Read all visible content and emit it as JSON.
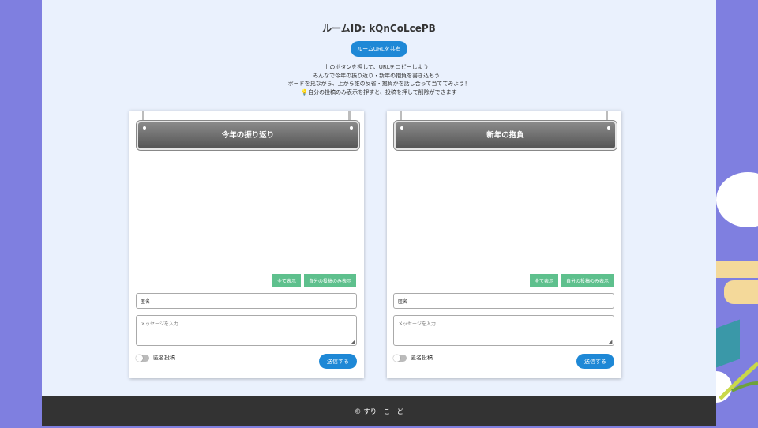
{
  "header": {
    "room_title": "ルームID: kQnCoLcePB",
    "share_button": "ルームURLを共有",
    "intro_lines": [
      "上のボタンを押して、URLをコピーしよう！",
      "みんなで今年の振り返り・新年の抱負を書き込もう！",
      "ボードを見ながら、上から誰の反省・抱負かを話し合って当ててみよう！",
      "自分の投稿のみ表示を押すと、投稿を押して削除ができます"
    ],
    "tip_icon": "lightbulb-icon"
  },
  "boards": [
    {
      "title": "今年の振り返り",
      "show_all": "全て表示",
      "show_mine": "自分の投稿のみ表示",
      "name_value": "匿名",
      "message_placeholder": "メッセージを入力",
      "anonymous_label": "匿名投稿",
      "anonymous_on": false,
      "send": "送信する"
    },
    {
      "title": "新年の抱負",
      "show_all": "全て表示",
      "show_mine": "自分の投稿のみ表示",
      "name_value": "匿名",
      "message_placeholder": "メッセージを入力",
      "anonymous_label": "匿名投稿",
      "anonymous_on": false,
      "send": "送信する"
    }
  ],
  "footer": {
    "copyright": "© すりーこーど"
  },
  "colors": {
    "primary": "#1e88d6",
    "filter": "#5ec08d",
    "page_bg": "#eaf1fd",
    "outer_bg": "#7f7fe0",
    "footer_bg": "#333333"
  }
}
